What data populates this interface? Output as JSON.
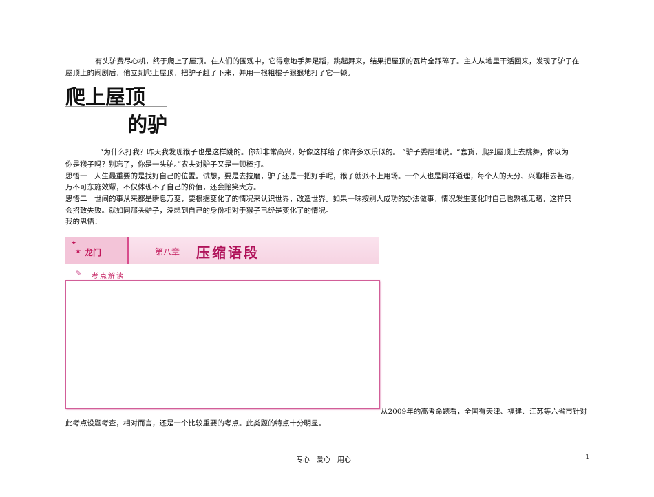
{
  "intro": [
    "有头驴费尽心机，终于爬上了屋顶。在人们的围观中，它得意地手舞足蹈，跳起舞来，结果把屋顶的瓦片全踩碎了。主人从地里干活回来，发现了驴子在",
    "屋顶上的闹剧后，他立刻爬上屋顶，把驴子赶了下来，并用一根粗棍子狠狠地打了它一顿。"
  ],
  "title_line1": "爬上屋顶",
  "title_line2": "的驴",
  "body": [
    "“为什么打我？昨天我发现猴子也是这样跳的。你却非常高兴，好像这样给了你许多欢乐似的。 ”驴子委屈地说。“蠢货，爬到屋顶上去跳舞，你以为",
    "你是猴子吗？别忘了，你是一头驴。”农夫对驴子又是一顿棒打。",
    "思悟一　人生最重要的是找好自己的位置。试想，要是去拉磨，驴子还是一把好手呢，猴子就派不上用场。一个人也是同样道理，每个人的天分、兴趣相去甚远，",
    "万不可东施效颦，不仅体现不了自己的价值，还会贻笑大方。",
    "思悟二　世间的事从来都是瞬息万变，要根据变化了的情况来认识世界，改造世界。如果一味按别人成功的办法做事，情况发生变化时自己也熟视无睹，这样只",
    "会招致失败。就如同那头驴子，没想到自己的身份相对于猴子已经是变化了的情况。"
  ],
  "my_thoughts_label": "我的思悟：",
  "banner": {
    "logo": "龙门",
    "chapter": "第八章",
    "title": "压缩语段",
    "section": "考点解读"
  },
  "after": [
    "从2009年的高考命题看，全国有天津、福建、江苏等六省市针对",
    "此考点设题考查，相对而言，还是一个比较重要的考点。此类题的特点十分明显。"
  ],
  "footer": {
    "center": "专心　爱心　用心",
    "page": "1"
  }
}
